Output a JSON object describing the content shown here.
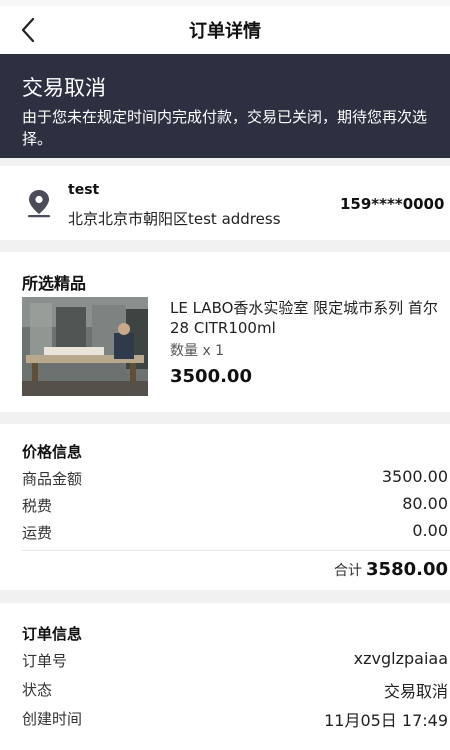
{
  "header": {
    "title": "订单详情",
    "back_icon": "chevron-left-icon"
  },
  "banner": {
    "title": "交易取消",
    "message": "由于您未在规定时间内完成付款，交易已关闭，期待您再次选择。",
    "background": "#2d3040"
  },
  "address": {
    "icon": "location-pin-icon",
    "name": "test",
    "address": "北京北京市朝阳区test address",
    "phone": "159****0000"
  },
  "goods": {
    "section_title": "所选精品",
    "product_name": "LE LABO香水实验室 限定城市系列 首尔28 CITR100ml",
    "quantity": "数量 x 1",
    "price": "3500.00"
  },
  "price_info": {
    "section_title": "价格信息",
    "rows": [
      {
        "label": "商品金额",
        "value": "3500.00"
      },
      {
        "label": "税费",
        "value": "80.00"
      },
      {
        "label": "运费",
        "value": "0.00"
      }
    ],
    "total_label": "合计",
    "total_value": "3580.00"
  },
  "order_info": {
    "section_title": "订单信息",
    "rows": [
      {
        "label": "订单号",
        "value": "xzvglzpaiaa"
      },
      {
        "label": "状态",
        "value": "交易取消"
      },
      {
        "label": "创建时间",
        "value": "11月05日 17:49"
      }
    ]
  }
}
